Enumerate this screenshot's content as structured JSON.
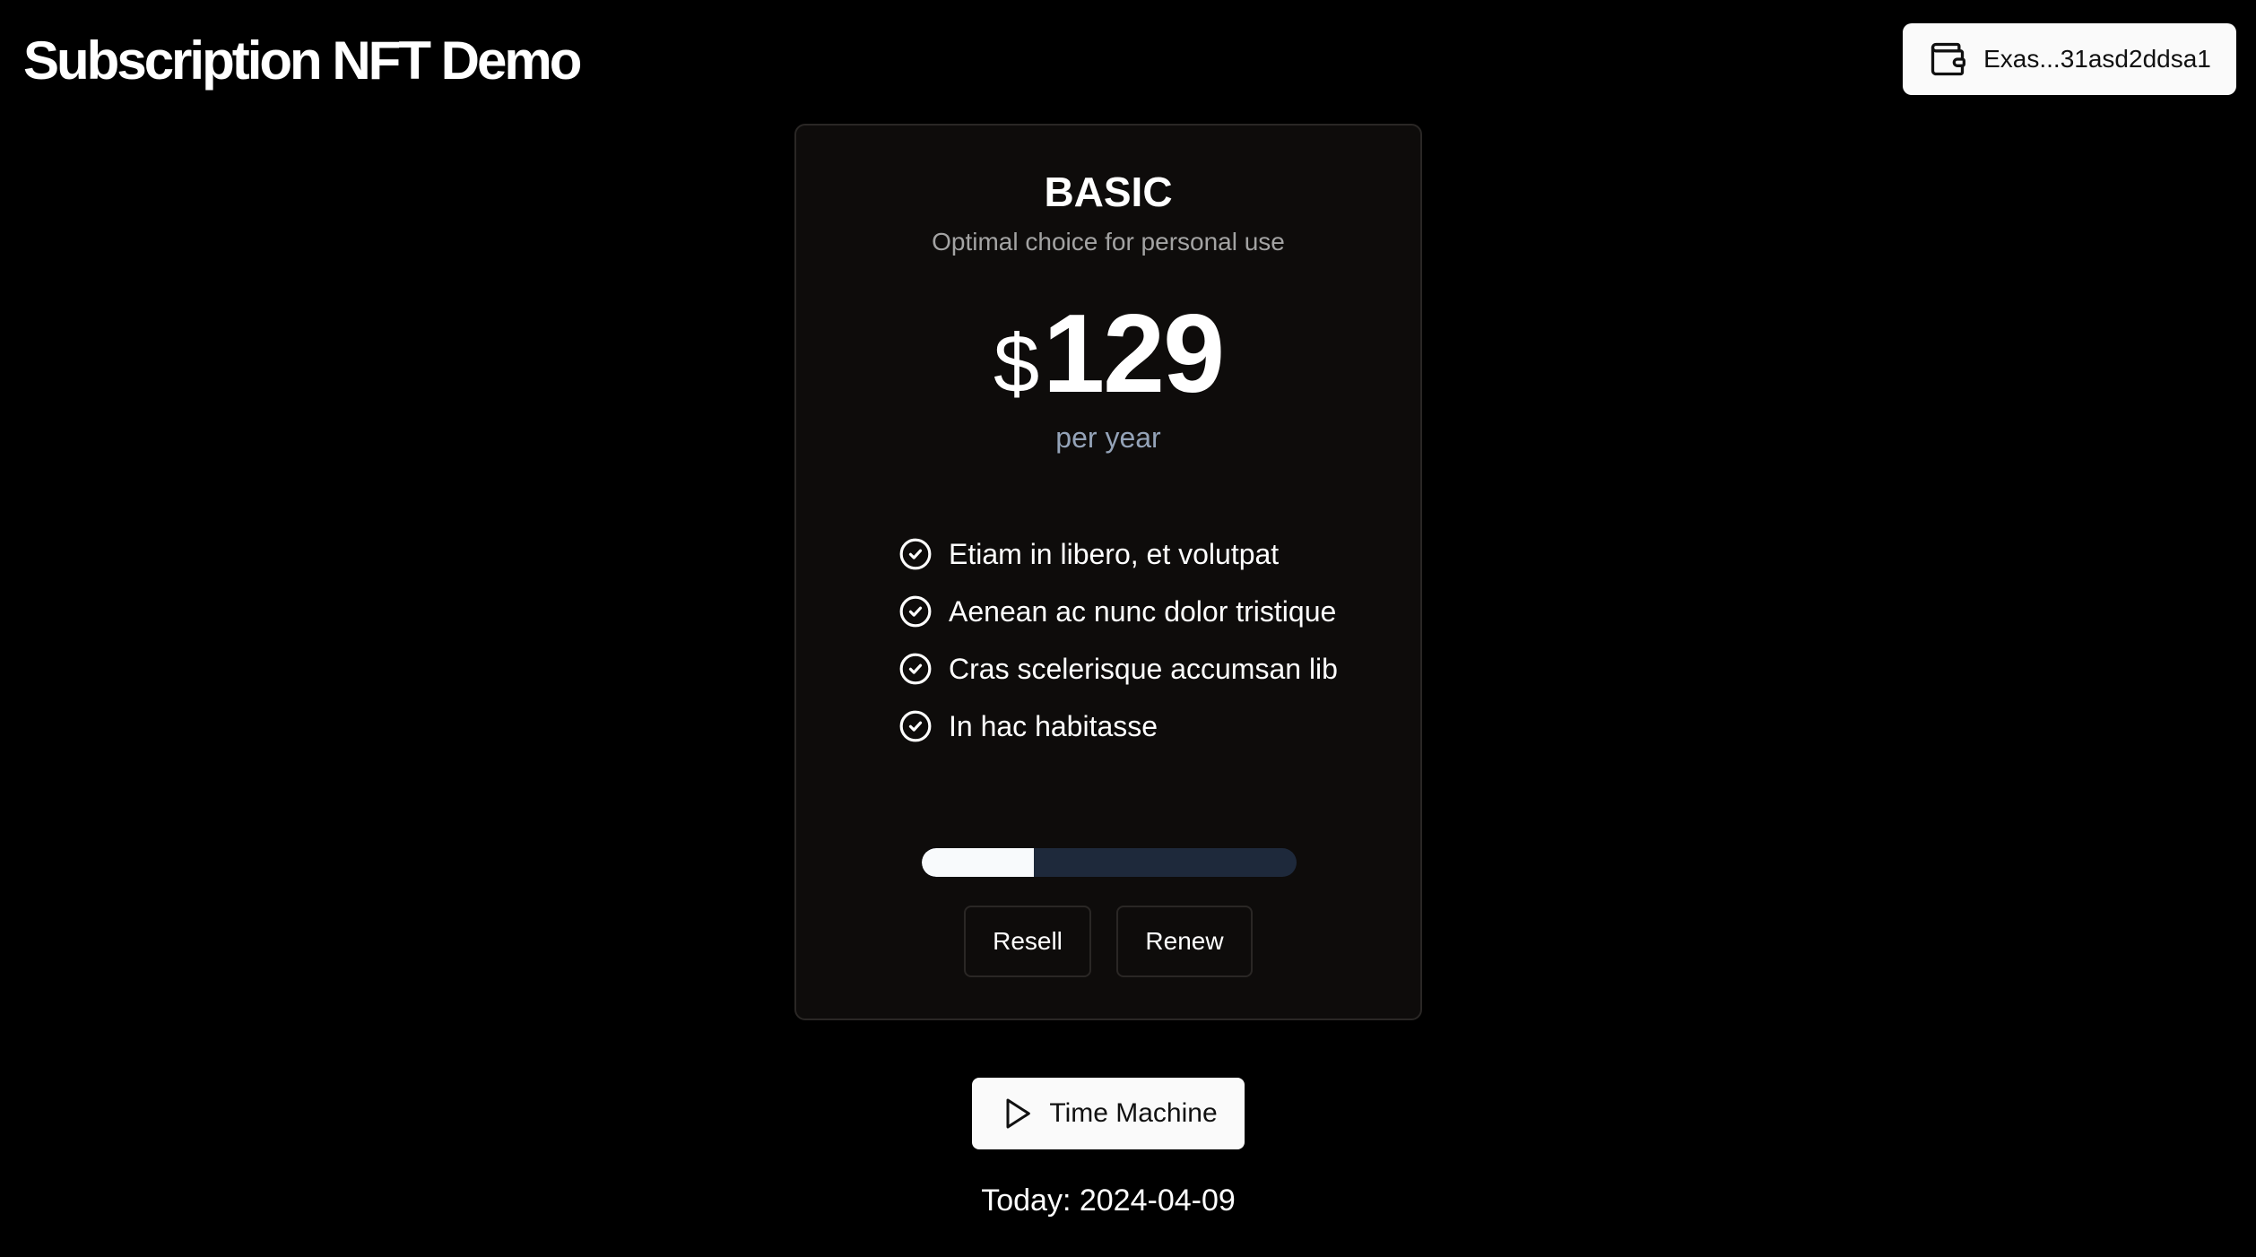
{
  "header": {
    "title": "Subscription NFT Demo",
    "wallet": {
      "icon": "wallet-icon",
      "address": "Exas...31asd2ddsa1"
    }
  },
  "plan": {
    "name": "BASIC",
    "subtitle": "Optimal choice for personal use",
    "currency": "$",
    "amount": "129",
    "period": "per year",
    "features": [
      {
        "icon": "check-circle-icon",
        "text": "Etiam in libero, et volutpat"
      },
      {
        "icon": "check-circle-icon",
        "text": "Aenean ac nunc dolor tristique"
      },
      {
        "icon": "check-circle-icon",
        "text": "Cras scelerisque accumsan lib"
      },
      {
        "icon": "check-circle-icon",
        "text": "In hac habitasse"
      }
    ],
    "progress_percent": 30,
    "actions": {
      "resell_label": "Resell",
      "renew_label": "Renew"
    }
  },
  "time_machine": {
    "icon": "play-icon",
    "label": "Time Machine"
  },
  "today": {
    "label": "Today:",
    "date": "2024-04-09"
  },
  "colors": {
    "background": "#000000",
    "card_background": "#0e0c0b",
    "card_border": "#2a2725",
    "progress_track": "#1e293b",
    "progress_fill": "#f8fafc",
    "period_text": "#94a3b8",
    "subtitle_text": "#a3a3a3",
    "light_button": "#fafafa"
  }
}
